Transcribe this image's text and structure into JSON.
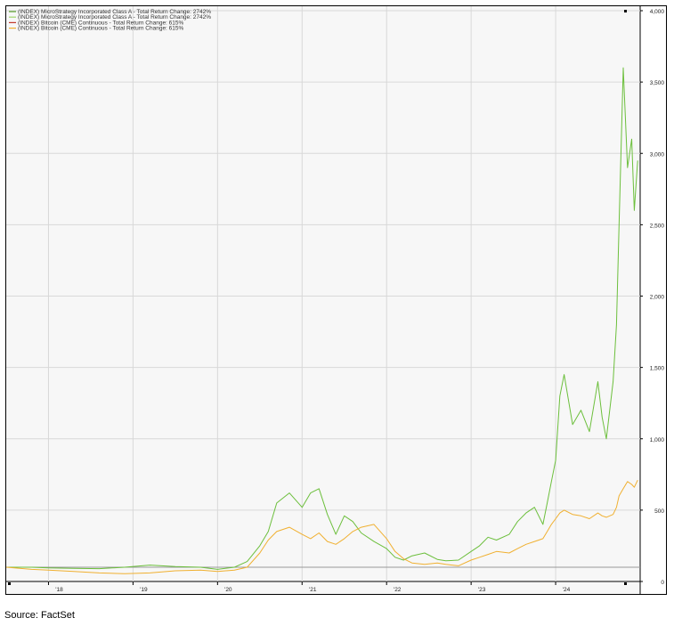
{
  "chart_data": {
    "type": "line",
    "ylim": [
      0,
      4000
    ],
    "y_ticks": [
      {
        "value": 0,
        "label": "0"
      },
      {
        "value": 500,
        "label": "500"
      },
      {
        "value": 1000,
        "label": "1,000"
      },
      {
        "value": 1500,
        "label": "1,500"
      },
      {
        "value": 2000,
        "label": "2,000"
      },
      {
        "value": 2500,
        "label": "2,500"
      },
      {
        "value": 3000,
        "label": "3,000"
      },
      {
        "value": 3500,
        "label": "3,500"
      },
      {
        "value": 4000,
        "label": "4,000"
      }
    ],
    "x_range": [
      2017.5,
      2025.0
    ],
    "x_ticks": [
      {
        "value": 2018,
        "label": "'18"
      },
      {
        "value": 2019,
        "label": "'19"
      },
      {
        "value": 2020,
        "label": "'20"
      },
      {
        "value": 2021,
        "label": "'21"
      },
      {
        "value": 2022,
        "label": "'22"
      },
      {
        "value": 2023,
        "label": "'23"
      },
      {
        "value": 2024,
        "label": "'24"
      }
    ],
    "baseline": 100,
    "grid": true,
    "legend_position": "top-left",
    "legend": [
      {
        "text": "(INDEX) MicroStrategy Incorporated Class A - Total Return   Change: 2742%",
        "color": "#5aa02c"
      },
      {
        "text": "(INDEX) MicroStrategy Incorporated Class A - Total Return   Change: 2742%",
        "color": "#9fd66b"
      },
      {
        "text": "(INDEX) Bitcoin (CME) Continuous - Total Return   Change: 615%",
        "color": "#c0392b"
      },
      {
        "text": "(INDEX) Bitcoin (CME) Continuous - Total Return   Change: 615%",
        "color": "#f0b030"
      }
    ],
    "series": [
      {
        "color": "#6cbf3c",
        "x": [
          2017.5,
          2017.8,
          2018.0,
          2018.3,
          2018.6,
          2018.9,
          2019.2,
          2019.5,
          2019.8,
          2020.0,
          2020.2,
          2020.35,
          2020.5,
          2020.6,
          2020.7,
          2020.85,
          2021.0,
          2021.1,
          2021.2,
          2021.3,
          2021.4,
          2021.5,
          2021.6,
          2021.7,
          2021.85,
          2022.0,
          2022.1,
          2022.2,
          2022.3,
          2022.45,
          2022.6,
          2022.7,
          2022.85,
          2023.0,
          2023.1,
          2023.2,
          2023.3,
          2023.45,
          2023.55,
          2023.65,
          2023.75,
          2023.85,
          2023.9,
          2023.95,
          2024.0,
          2024.05,
          2024.1,
          2024.2,
          2024.3,
          2024.4,
          2024.5,
          2024.55,
          2024.6,
          2024.68,
          2024.72,
          2024.75,
          2024.8,
          2024.85,
          2024.9,
          2024.93,
          2024.97
        ],
        "values": [
          100,
          100,
          95,
          92,
          90,
          100,
          115,
          105,
          100,
          85,
          100,
          140,
          250,
          350,
          550,
          620,
          520,
          620,
          650,
          470,
          330,
          460,
          420,
          340,
          280,
          230,
          170,
          150,
          180,
          200,
          155,
          145,
          150,
          210,
          250,
          310,
          290,
          330,
          420,
          480,
          520,
          400,
          550,
          700,
          850,
          1300,
          1450,
          1100,
          1200,
          1050,
          1400,
          1150,
          1000,
          1400,
          1800,
          2500,
          3600,
          2900,
          3100,
          2600,
          2950
        ]
      },
      {
        "color": "#f0b030",
        "x": [
          2017.5,
          2017.8,
          2018.0,
          2018.3,
          2018.6,
          2018.9,
          2019.2,
          2019.5,
          2019.8,
          2020.0,
          2020.2,
          2020.35,
          2020.5,
          2020.6,
          2020.7,
          2020.85,
          2021.0,
          2021.1,
          2021.2,
          2021.3,
          2021.4,
          2021.5,
          2021.6,
          2021.7,
          2021.85,
          2022.0,
          2022.1,
          2022.2,
          2022.3,
          2022.45,
          2022.6,
          2022.7,
          2022.85,
          2023.0,
          2023.1,
          2023.2,
          2023.3,
          2023.45,
          2023.55,
          2023.65,
          2023.75,
          2023.85,
          2023.9,
          2023.95,
          2024.0,
          2024.05,
          2024.1,
          2024.2,
          2024.3,
          2024.4,
          2024.5,
          2024.55,
          2024.6,
          2024.68,
          2024.72,
          2024.75,
          2024.8,
          2024.85,
          2024.9,
          2024.93,
          2024.97
        ],
        "values": [
          100,
          85,
          80,
          70,
          60,
          55,
          60,
          75,
          80,
          70,
          80,
          100,
          200,
          290,
          350,
          380,
          330,
          300,
          340,
          280,
          260,
          300,
          350,
          380,
          400,
          300,
          210,
          160,
          130,
          120,
          130,
          120,
          110,
          150,
          170,
          190,
          210,
          200,
          230,
          260,
          280,
          300,
          350,
          400,
          440,
          480,
          500,
          470,
          460,
          440,
          480,
          460,
          450,
          470,
          520,
          600,
          650,
          700,
          680,
          660,
          710
        ]
      }
    ]
  },
  "source": "Source: FactSet"
}
